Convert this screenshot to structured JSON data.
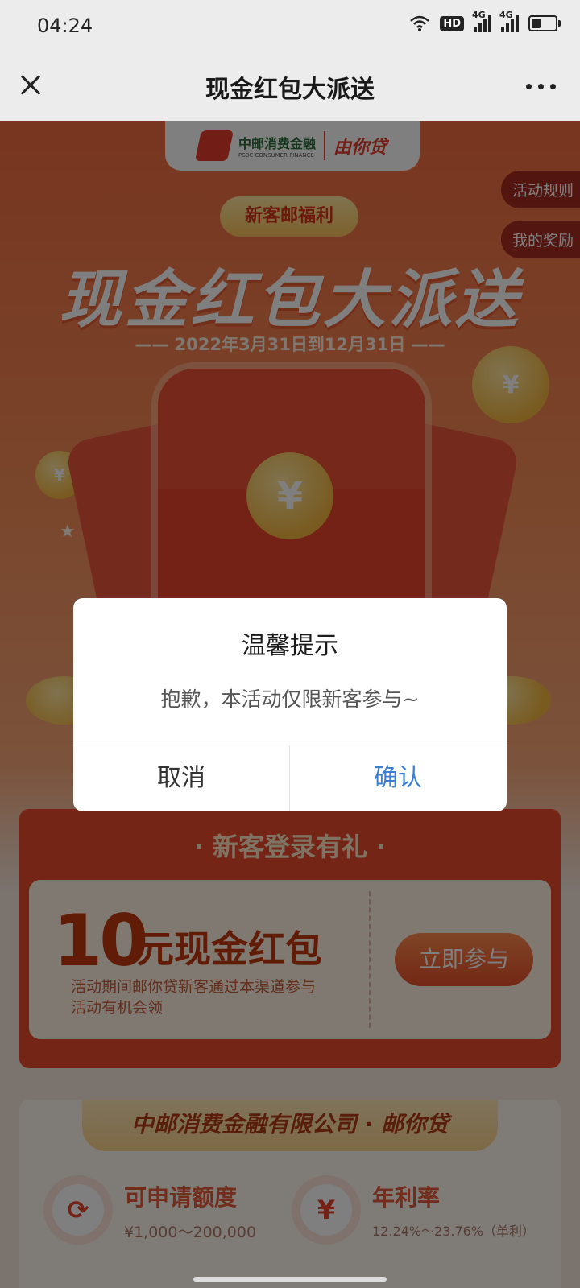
{
  "status_bar": {
    "time": "04:24",
    "hd": "HD",
    "net1": "4G",
    "net2": "4G",
    "battery_level": 0.4
  },
  "nav": {
    "title": "现金红包大派送",
    "close_icon": "close-icon",
    "more_icon": "more-icon"
  },
  "logo": {
    "name_cn": "中邮消费金融",
    "name_en": "PSBC CONSUMER FINANCE",
    "brand": "由你贷"
  },
  "side_buttons": {
    "rules": "活动规则",
    "my_rewards": "我的奖励"
  },
  "hero": {
    "badge": "新客邮福利",
    "title": "现金红包大派送",
    "date_range": "—— 2022年3月31日到12月31日 ——",
    "coin_symbol": "¥"
  },
  "section_login": {
    "title": "· 新客登录有礼 ·",
    "amount": "10",
    "amount_unit": "元现金红包",
    "desc": "活动期间邮你贷新客通过本渠道参与活动有机会领",
    "join_button": "立即参与"
  },
  "section_company": {
    "banner": "中邮消费金融有限公司 · 邮你贷",
    "features": [
      {
        "icon": "refresh-icon",
        "label": "可申请额度",
        "value": "¥1,000～200,000"
      },
      {
        "icon": "yuan-icon",
        "label": "年利率",
        "value": "12.24%～23.76%（单利）"
      }
    ]
  },
  "dialog": {
    "title": "温馨提示",
    "message": "抱歉，本活动仅限新客参与~",
    "cancel": "取消",
    "confirm": "确认"
  },
  "colors": {
    "accent": "#3a7fd4",
    "brand_red": "#e8442a",
    "overlay": "rgba(0,0,0,0.5)"
  }
}
